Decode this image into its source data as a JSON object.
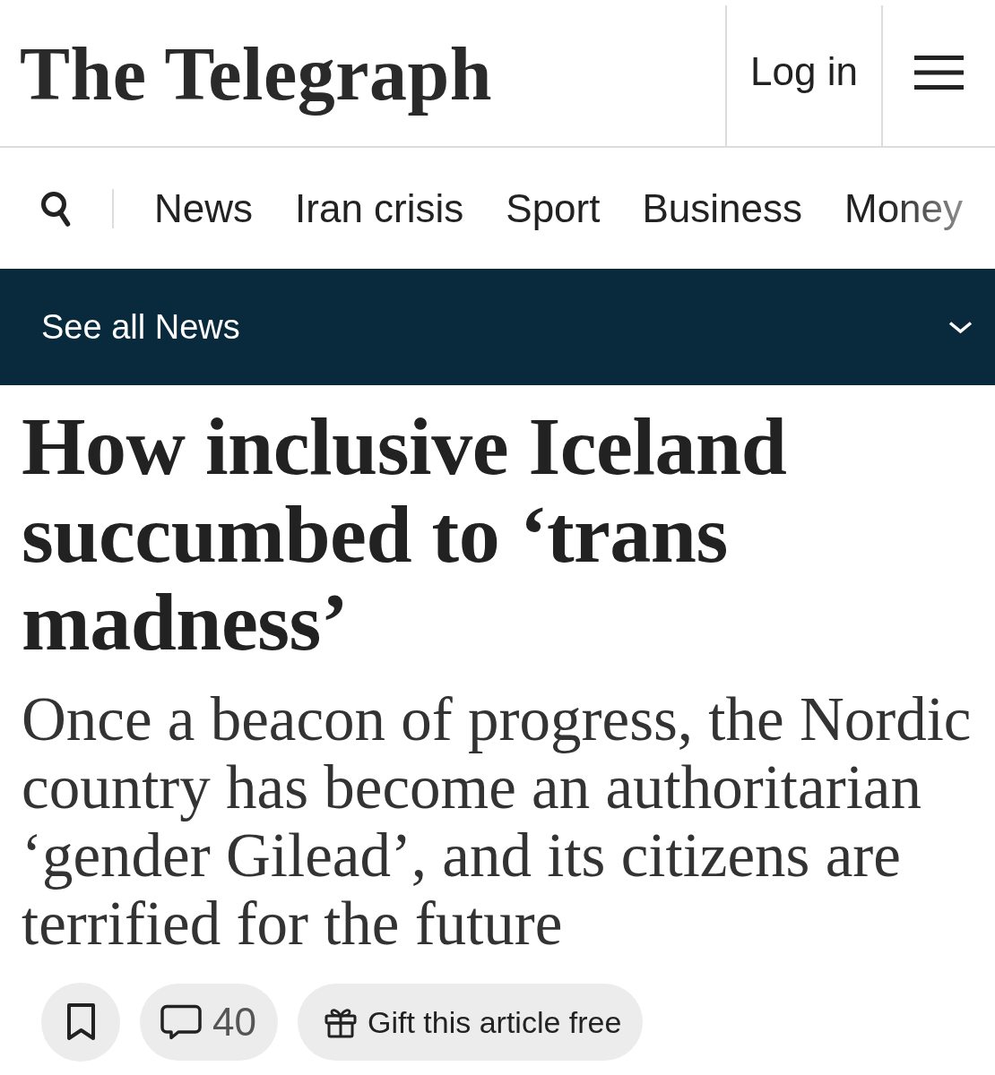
{
  "header": {
    "logo": "The Telegraph",
    "login": "Log in"
  },
  "nav": {
    "items": [
      "News",
      "Iran crisis",
      "Sport",
      "Business",
      "Money"
    ]
  },
  "section_bar": {
    "label": "See all News",
    "expanded": false
  },
  "article": {
    "headline": "How inclusive Iceland succumbed to ‘trans madness’",
    "standfirst": "Once a beacon of progress, the Nordic country has become an authoritarian ‘gender Gilead’, and its citizens are terrified for the future"
  },
  "actions": {
    "bookmark": {
      "saved": false
    },
    "comments": {
      "count": "40"
    },
    "gift": {
      "label": "Gift this article free"
    }
  }
}
